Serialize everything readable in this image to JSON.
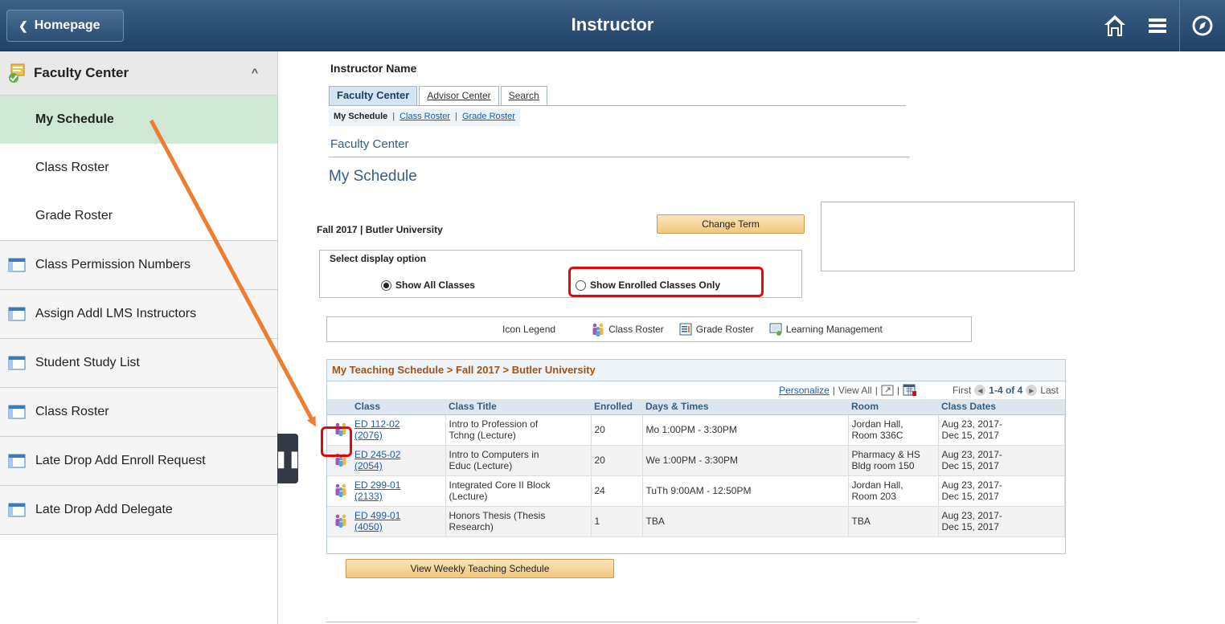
{
  "banner": {
    "back_label": "Homepage",
    "title": "Instructor",
    "icons": [
      "home-icon",
      "hamburger-menu-icon",
      "navbar-compass-icon"
    ]
  },
  "sidebar": {
    "header": "Faculty Center",
    "subitems": [
      {
        "label": "My Schedule",
        "active": true
      },
      {
        "label": "Class Roster",
        "active": false
      },
      {
        "label": "Grade Roster",
        "active": false
      }
    ],
    "items": [
      {
        "label": "Class Permission Numbers"
      },
      {
        "label": "Assign Addl LMS Instructors"
      },
      {
        "label": "Student Study List"
      },
      {
        "label": "Class Roster"
      },
      {
        "label": "Late Drop Add Enroll Request"
      },
      {
        "label": "Late Drop Add Delegate"
      }
    ]
  },
  "main": {
    "instructor_name": "Instructor Name",
    "tabs": [
      {
        "label": "Faculty Center",
        "active": true
      },
      {
        "label": "Advisor Center",
        "active": false
      },
      {
        "label": "Search",
        "active": false
      }
    ],
    "subnav": {
      "current": "My Schedule",
      "links": [
        "Class Roster",
        "Grade Roster"
      ],
      "sep": "|"
    },
    "section_label": "Faculty Center",
    "page_title": "My Schedule",
    "term": "Fall 2017 | Butler University",
    "change_term_label": "Change Term",
    "display_option": {
      "label": "Select display option",
      "options": [
        {
          "label": "Show All Classes",
          "selected": true
        },
        {
          "label": "Show Enrolled Classes Only",
          "selected": false
        }
      ]
    },
    "legend": {
      "title": "Icon Legend",
      "items": [
        "Class Roster",
        "Grade Roster",
        "Learning Management"
      ]
    },
    "grid": {
      "title": "My Teaching Schedule > Fall 2017 > Butler University",
      "personalize": "Personalize",
      "view_all": "View All",
      "nav_sep": "|",
      "first": "First",
      "range": "1-4 of 4",
      "last": "Last",
      "columns": [
        "Class",
        "Class Title",
        "Enrolled",
        "Days & Times",
        "Room",
        "Class Dates"
      ],
      "rows": [
        {
          "class_line1": "ED 112-02",
          "class_line2": "(2076)",
          "title_line1": "Intro to Profession of",
          "title_line2": "Tchng (Lecture)",
          "enrolled": "20",
          "days": "Mo 1:00PM - 3:30PM",
          "room_line1": "Jordan Hall,",
          "room_line2": "Room 336C",
          "dates_line1": "Aug 23, 2017-",
          "dates_line2": "Dec 15, 2017"
        },
        {
          "class_line1": "ED 245-02",
          "class_line2": "(2054)",
          "title_line1": "Intro to Computers in",
          "title_line2": "Educ (Lecture)",
          "enrolled": "20",
          "days": "We 1:00PM - 3:30PM",
          "room_line1": "Pharmacy & HS",
          "room_line2": "Bldg room 150",
          "dates_line1": "Aug 23, 2017-",
          "dates_line2": "Dec 15, 2017"
        },
        {
          "class_line1": "ED 299-01",
          "class_line2": "(2133)",
          "title_line1": "Integrated Core II Block",
          "title_line2": "(Lecture)",
          "enrolled": "24",
          "days": "TuTh 9:00AM - 12:50PM",
          "room_line1": "Jordan Hall,",
          "room_line2": "Room 203",
          "dates_line1": "Aug 23, 2017-",
          "dates_line2": "Dec 15, 2017"
        },
        {
          "class_line1": "ED 499-01",
          "class_line2": "(4050)",
          "title_line1": "Honors Thesis (Thesis",
          "title_line2": "Research)",
          "enrolled": "1",
          "days": "TBA",
          "room_line1": "TBA",
          "room_line2": "",
          "dates_line1": "Aug 23, 2017-",
          "dates_line2": "Dec 15, 2017"
        }
      ]
    },
    "weekly_button_label": "View Weekly Teaching Schedule"
  },
  "colors": {
    "banner": "#2a4d72",
    "active_sidebar": "#cfe8d6",
    "highlight_box": "#e4080a",
    "annotation_arrow": "#ee7d2f",
    "grid_title": "#a0521d"
  }
}
